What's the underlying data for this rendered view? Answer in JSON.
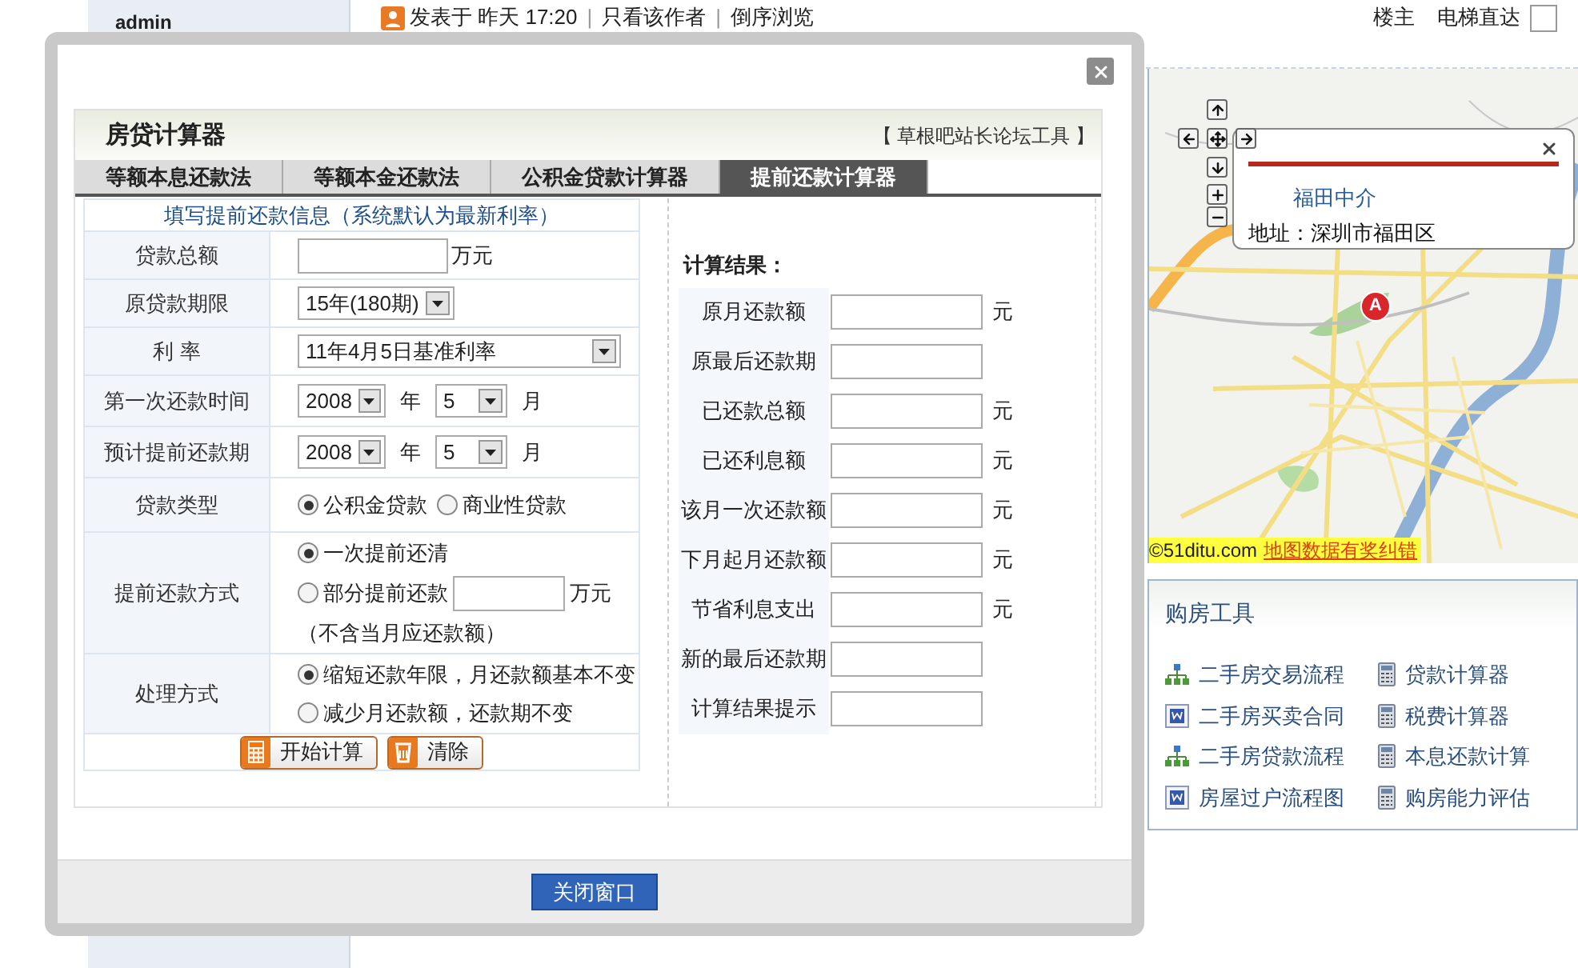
{
  "page": {
    "author": "admin",
    "post_info": [
      "发表于 昨天 17:20",
      "只看该作者",
      "倒序浏览"
    ],
    "separator": "|",
    "links": [
      "楼主",
      "电梯直达"
    ]
  },
  "map": {
    "marker": "A",
    "popup": {
      "title": "福田中介",
      "address": "地址：深圳市福田区"
    },
    "copyright": "©51ditu.com",
    "error_link": "地图数据有奖纠错"
  },
  "tools": {
    "title": "购房工具",
    "items": [
      {
        "label": "二手房交易流程",
        "kind": "sitemap"
      },
      {
        "label": "贷款计算器",
        "kind": "calculator"
      },
      {
        "label": "二手房买卖合同",
        "kind": "document"
      },
      {
        "label": "税费计算器",
        "kind": "calculator"
      },
      {
        "label": "二手房贷款流程",
        "kind": "sitemap"
      },
      {
        "label": "本息还款计算",
        "kind": "calculator"
      },
      {
        "label": "房屋过户流程图",
        "kind": "document"
      },
      {
        "label": "购房能力评估",
        "kind": "calculator"
      }
    ]
  },
  "dialog": {
    "title": "房贷计算器",
    "credit": "【 草根吧站长论坛工具 】",
    "tabs": [
      {
        "label": "等额本息还款法",
        "selected": false
      },
      {
        "label": "等额本金还款法",
        "selected": false
      },
      {
        "label": "公积金贷款计算器",
        "selected": false
      },
      {
        "label": "提前还款计算器",
        "selected": true
      }
    ],
    "form": {
      "heading": "填写提前还款信息（系统默认为最新利率）",
      "rows": [
        {
          "kind": "text",
          "label": "贷款总额",
          "unit": "万元"
        },
        {
          "kind": "select",
          "label": "原贷款期限",
          "value": "15年(180期)",
          "wide": false
        },
        {
          "kind": "select",
          "label": "利 率",
          "value": "11年4月5日基准利率",
          "wide": true
        },
        {
          "kind": "date",
          "label": "第一次还款时间",
          "year": "2008",
          "year_unit": "年",
          "month": "5",
          "month_unit": "月"
        },
        {
          "kind": "date",
          "label": "预计提前还款期",
          "year": "2008",
          "year_unit": "年",
          "month": "5",
          "month_unit": "月"
        },
        {
          "kind": "radio-inline",
          "label": "贷款类型",
          "options": [
            {
              "label": "公积金贷款",
              "selected": true
            },
            {
              "label": "商业性贷款",
              "selected": false
            }
          ]
        },
        {
          "kind": "radio-stack",
          "label": "提前还款方式",
          "options": [
            {
              "label": "一次提前还清",
              "selected": true
            },
            {
              "label": "部分提前还款",
              "selected": false,
              "unit": "万元"
            }
          ],
          "note": "（不含当月应还款额）"
        },
        {
          "kind": "radio-stack",
          "label": "处理方式",
          "options": [
            {
              "label": "缩短还款年限，月还款额基本不变",
              "selected": true
            },
            {
              "label": "减少月还款额，还款期不变",
              "selected": false
            }
          ]
        }
      ],
      "buttons": [
        {
          "label": "开始计算",
          "kind": "calculate"
        },
        {
          "label": "清除",
          "kind": "clear"
        }
      ]
    },
    "results": {
      "title": "计算结果：",
      "rows": [
        {
          "label": "原月还款额",
          "unit": "元"
        },
        {
          "label": "原最后还款期"
        },
        {
          "label": "已还款总额",
          "unit": "元"
        },
        {
          "label": "已还利息额",
          "unit": "元"
        },
        {
          "label": "该月一次还款额",
          "unit": "元"
        },
        {
          "label": "下月起月还款额",
          "unit": "元"
        },
        {
          "label": "节省利息支出",
          "unit": "元"
        },
        {
          "label": "新的最后还款期"
        },
        {
          "label": "计算结果提示"
        }
      ]
    },
    "close_button": "关闭窗口"
  }
}
